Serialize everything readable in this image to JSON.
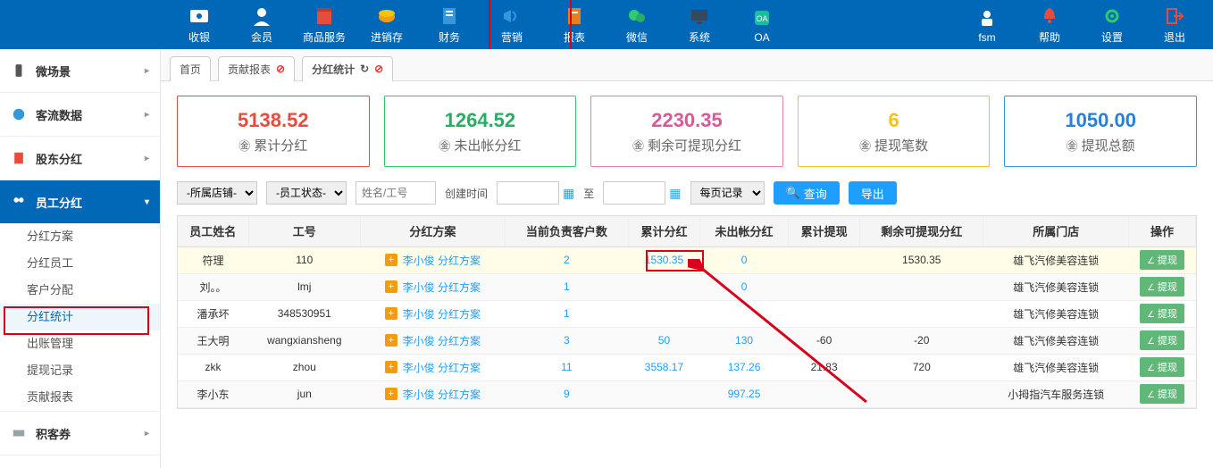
{
  "topnav": {
    "items": [
      {
        "label": "收银",
        "icon": "cash"
      },
      {
        "label": "会员",
        "icon": "user"
      },
      {
        "label": "商品服务",
        "icon": "goods"
      },
      {
        "label": "进销存",
        "icon": "stock"
      },
      {
        "label": "财务",
        "icon": "finance"
      },
      {
        "label": "营销",
        "icon": "speaker"
      },
      {
        "label": "报表",
        "icon": "report"
      },
      {
        "label": "微信",
        "icon": "wechat"
      },
      {
        "label": "系统",
        "icon": "system"
      },
      {
        "label": "OA",
        "icon": "oa"
      }
    ],
    "right": [
      {
        "label": "fsm",
        "icon": "person"
      },
      {
        "label": "帮助",
        "icon": "bell"
      },
      {
        "label": "设置",
        "icon": "gear"
      },
      {
        "label": "退出",
        "icon": "exit"
      }
    ]
  },
  "sidebar": {
    "groups": [
      {
        "label": "微场景",
        "icon": "phone",
        "expanded": false
      },
      {
        "label": "客流数据",
        "icon": "globe",
        "expanded": false
      },
      {
        "label": "股东分红",
        "icon": "note",
        "expanded": false
      },
      {
        "label": "员工分红",
        "icon": "people",
        "expanded": true,
        "active": true,
        "subs": [
          "分红方案",
          "分红员工",
          "客户分配",
          "分红统计",
          "出账管理",
          "提现记录",
          "贡献报表"
        ],
        "selected": "分红统计"
      },
      {
        "label": "积客券",
        "icon": "ticket",
        "expanded": false
      }
    ]
  },
  "tabs": [
    {
      "label": "首页",
      "closable": false
    },
    {
      "label": "贡献报表",
      "closable": true
    },
    {
      "label": "分红统计",
      "closable": true,
      "refresh": true,
      "active": true
    }
  ],
  "cards": [
    {
      "value": "5138.52",
      "label": "累计分红",
      "currency": true,
      "cls": "c-red"
    },
    {
      "value": "1264.52",
      "label": "未出帐分红",
      "currency": true,
      "cls": "c-green"
    },
    {
      "value": "2230.35",
      "label": "剩余可提现分红",
      "currency": true,
      "cls": "c-pink"
    },
    {
      "value": "6",
      "label": "提现笔数",
      "currency": true,
      "cls": "c-yellow"
    },
    {
      "value": "1050.00",
      "label": "提现总额",
      "currency": true,
      "cls": "c-blue"
    }
  ],
  "filters": {
    "store": "-所属店铺-",
    "status": "-员工状态-",
    "name_placeholder": "姓名/工号",
    "create_label": "创建时间",
    "to_label": "至",
    "page_label": "每页记录",
    "query_btn": "查询",
    "export_btn": "导出"
  },
  "table": {
    "headers": [
      "员工姓名",
      "工号",
      "分红方案",
      "当前负责客户数",
      "累计分红",
      "未出帐分红",
      "累计提现",
      "剩余可提现分红",
      "所属门店",
      "操作"
    ],
    "op_label": "提现",
    "rows": [
      {
        "name": "符理",
        "no": "110",
        "plan": "李小俊 分红方案",
        "customers": "2",
        "total": "1530.35",
        "unpaid": "0",
        "withdrawn": "",
        "remain": "1530.35",
        "store": "雄飞汽修美容连锁",
        "hl": true
      },
      {
        "name": "刘。。",
        "no": "lmj",
        "plan": "李小俊 分红方案",
        "customers": "1",
        "total": "",
        "unpaid": "0",
        "withdrawn": "",
        "remain": "",
        "store": "雄飞汽修美容连锁"
      },
      {
        "name": "潘承坏",
        "no": "348530951",
        "plan": "李小俊 分红方案",
        "customers": "1",
        "total": "",
        "unpaid": "",
        "withdrawn": "",
        "remain": "",
        "store": "雄飞汽修美容连锁"
      },
      {
        "name": "王大明",
        "no": "wangxiansheng",
        "plan": "李小俊 分红方案",
        "customers": "3",
        "total": "50",
        "unpaid": "130",
        "withdrawn": "-60",
        "remain": "-20",
        "store": "雄飞汽修美容连锁"
      },
      {
        "name": "zkk",
        "no": "zhou",
        "plan": "李小俊 分红方案",
        "customers": "11",
        "total": "3558.17",
        "unpaid": "137.26",
        "withdrawn": "21.83",
        "remain": "720",
        "store": "雄飞汽修美容连锁"
      },
      {
        "name": "李小东",
        "no": "jun",
        "plan": "李小俊 分红方案",
        "customers": "9",
        "total": "",
        "unpaid": "997.25",
        "withdrawn": "",
        "remain": "",
        "store": "小拇指汽车服务连锁"
      }
    ]
  }
}
